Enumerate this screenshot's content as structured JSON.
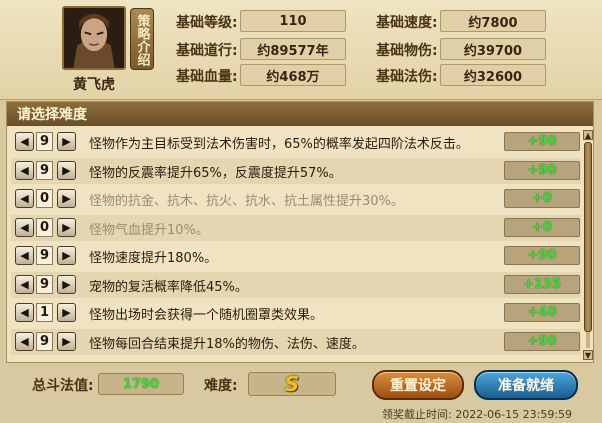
{
  "hero": {
    "name": "黄飞虎",
    "strategy_label": "策略介绍"
  },
  "stats": [
    {
      "label": "基础等级:",
      "value": "110"
    },
    {
      "label": "基础道行:",
      "value": "约89577年"
    },
    {
      "label": "基础血量:",
      "value": "约468万"
    },
    {
      "label": "基础速度:",
      "value": "约7800"
    },
    {
      "label": "基础物伤:",
      "value": "约39700"
    },
    {
      "label": "基础法伤:",
      "value": "约32600"
    }
  ],
  "difficulty_panel": {
    "title": "请选择难度",
    "rows": [
      {
        "level": "9",
        "text": "怪物作为主目标受到法术伤害时，65%的概率发起四阶法术反击。",
        "bonus": "+90",
        "dim": false
      },
      {
        "level": "9",
        "text": "怪物的反震率提升65%，反震度提升57%。",
        "bonus": "+90",
        "dim": false
      },
      {
        "level": "0",
        "text": "怪物的抗金、抗木、抗火、抗水、抗土属性提升30%。",
        "bonus": "+0",
        "dim": true
      },
      {
        "level": "0",
        "text": "怪物气血提升10%。",
        "bonus": "+0",
        "dim": true
      },
      {
        "level": "9",
        "text": "怪物速度提升180%。",
        "bonus": "+90",
        "dim": false
      },
      {
        "level": "9",
        "text": "宠物的复活概率降低45%。",
        "bonus": "+135",
        "dim": false
      },
      {
        "level": "1",
        "text": "怪物出场时会获得一个随机圈罩类效果。",
        "bonus": "+40",
        "dim": false
      },
      {
        "level": "9",
        "text": "怪物每回合结束提升18%的物伤、法伤、速度。",
        "bonus": "+90",
        "dim": false
      }
    ]
  },
  "footer": {
    "total_label": "总斗法值:",
    "total_value": "1790",
    "difficulty_label": "难度:",
    "difficulty_grade": "S",
    "reset_label": "重置设定",
    "ready_label": "准备就绪",
    "partial_text": "领奖截止时间: 2022-06-15 23:59:59"
  },
  "colors": {
    "bonus_green": "#3fd93a",
    "header_brown": "#6a4f26"
  }
}
